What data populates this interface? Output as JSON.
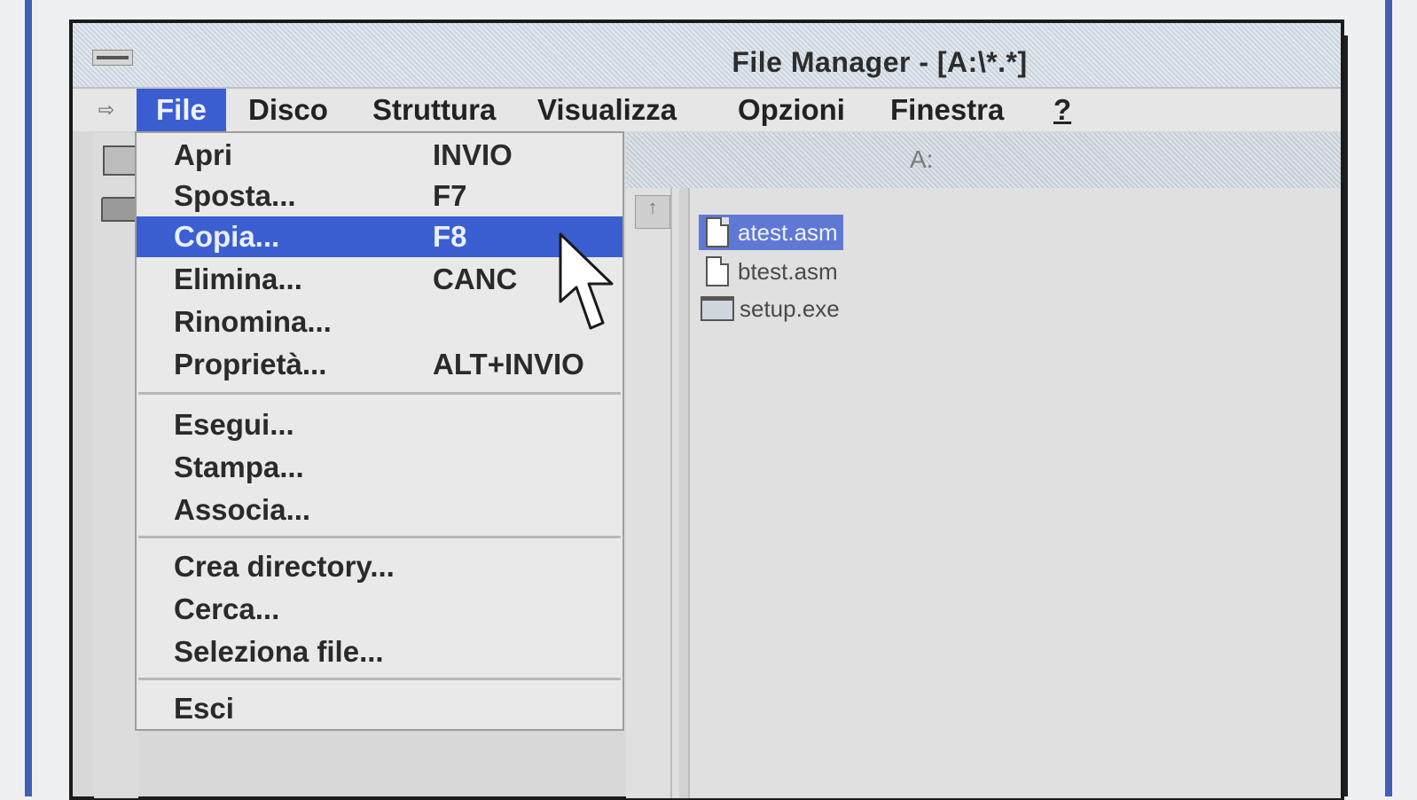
{
  "window": {
    "title": "File Manager - [A:\\*.*]"
  },
  "menubar": {
    "child_menu_icon": "child-system-menu-icon",
    "items": [
      {
        "label": "File"
      },
      {
        "label": "Disco"
      },
      {
        "label": "Struttura"
      },
      {
        "label": "Visualizza"
      },
      {
        "label": "Opzioni"
      },
      {
        "label": "Finestra"
      },
      {
        "label": "?"
      }
    ]
  },
  "file_menu": {
    "items": [
      {
        "label": "Apri",
        "shortcut": "INVIO"
      },
      {
        "label": "Sposta...",
        "shortcut": "F7"
      },
      {
        "label": "Copia...",
        "shortcut": "F8"
      },
      {
        "label": "Elimina...",
        "shortcut": "CANC"
      },
      {
        "label": "Rinomina...",
        "shortcut": ""
      },
      {
        "label": "Proprietà...",
        "shortcut": "ALT+INVIO"
      },
      {
        "label": "Esegui...",
        "shortcut": ""
      },
      {
        "label": "Stampa...",
        "shortcut": ""
      },
      {
        "label": "Associa...",
        "shortcut": ""
      },
      {
        "label": "Crea directory...",
        "shortcut": ""
      },
      {
        "label": "Cerca...",
        "shortcut": ""
      },
      {
        "label": "Seleziona file...",
        "shortcut": ""
      },
      {
        "label": "Esci",
        "shortcut": ""
      }
    ]
  },
  "file_pane": {
    "header": "A:",
    "files": [
      {
        "name": "atest.asm",
        "icon": "document-icon"
      },
      {
        "name": "btest.asm",
        "icon": "document-icon"
      },
      {
        "name": "setup.exe",
        "icon": "program-icon"
      }
    ]
  },
  "colors": {
    "menu_highlight": "#3b5fd0",
    "selection": "#5f78d6",
    "outer_border": "#3f5fb8"
  }
}
